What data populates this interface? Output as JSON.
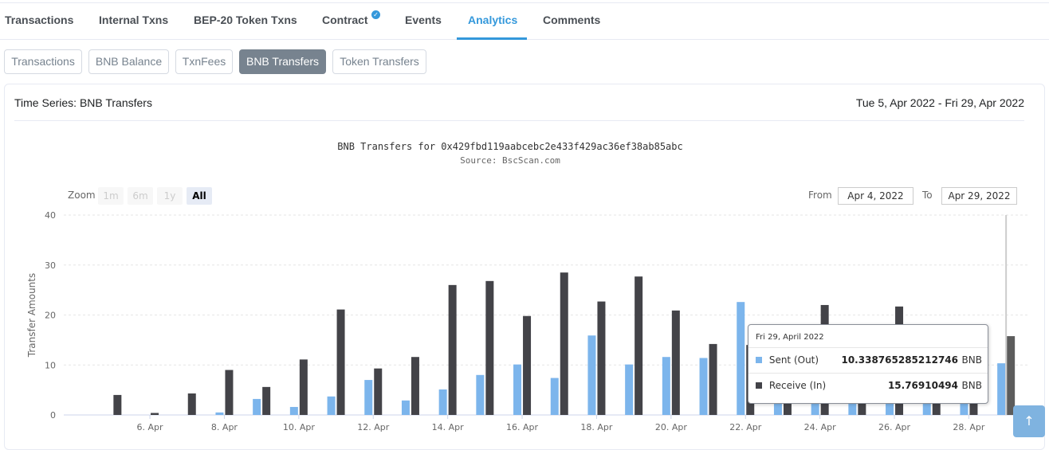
{
  "tabs": [
    {
      "label": "Transactions"
    },
    {
      "label": "Internal Txns"
    },
    {
      "label": "BEP-20 Token Txns"
    },
    {
      "label": "Contract"
    },
    {
      "label": "Events"
    },
    {
      "label": "Analytics"
    },
    {
      "label": "Comments"
    }
  ],
  "active_tab": "Analytics",
  "subtabs": [
    {
      "label": "Transactions"
    },
    {
      "label": "BNB Balance"
    },
    {
      "label": "TxnFees"
    },
    {
      "label": "BNB Transfers"
    },
    {
      "label": "Token Transfers"
    }
  ],
  "active_subtab": "BNB Transfers",
  "card": {
    "title": "Time Series: BNB Transfers",
    "range": "Tue 5, Apr 2022 - Fri 29, Apr 2022"
  },
  "chart_header": {
    "title": "BNB Transfers for 0x429fbd119aabcebc2e433f429ac36ef38ab85abc",
    "subtitle": "Source: BscScan.com"
  },
  "zoom": {
    "label": "Zoom",
    "options": [
      "1m",
      "6m",
      "1y",
      "All"
    ],
    "selected": "All"
  },
  "range_selector": {
    "from_label": "From",
    "from_value": "Apr 4, 2022",
    "to_label": "To",
    "to_value": "Apr 29, 2022"
  },
  "colors": {
    "accent": "#3498db",
    "sent": "#7cb5ec",
    "receive": "#434348"
  },
  "chart_data": {
    "type": "bar",
    "ylabel": "Transfer Amounts",
    "ylim": [
      0,
      40
    ],
    "yticks": [
      0,
      10,
      20,
      30,
      40
    ],
    "xticks": [
      "6. Apr",
      "8. Apr",
      "10. Apr",
      "12. Apr",
      "14. Apr",
      "16. Apr",
      "18. Apr",
      "20. Apr",
      "22. Apr",
      "24. Apr",
      "26. Apr",
      "28. Apr"
    ],
    "grid": true,
    "categories": [
      "2022-04-05",
      "2022-04-06",
      "2022-04-07",
      "2022-04-08",
      "2022-04-09",
      "2022-04-10",
      "2022-04-11",
      "2022-04-12",
      "2022-04-13",
      "2022-04-14",
      "2022-04-15",
      "2022-04-16",
      "2022-04-17",
      "2022-04-18",
      "2022-04-19",
      "2022-04-20",
      "2022-04-21",
      "2022-04-22",
      "2022-04-23",
      "2022-04-24",
      "2022-04-25",
      "2022-04-26",
      "2022-04-27",
      "2022-04-28",
      "2022-04-29"
    ],
    "series": [
      {
        "name": "Sent (Out)",
        "values": [
          0,
          0,
          0,
          0.5,
          3.2,
          1.6,
          3.7,
          7.0,
          2.9,
          5.1,
          8.0,
          10.1,
          7.4,
          15.9,
          10.1,
          11.6,
          11.4,
          22.6,
          4.0,
          3.0,
          3.0,
          3.0,
          3.0,
          3.0,
          10.338765285212746
        ]
      },
      {
        "name": "Receive (In)",
        "values": [
          4.0,
          0.4,
          4.3,
          9.0,
          5.6,
          11.1,
          21.1,
          9.3,
          11.6,
          26.0,
          26.8,
          19.8,
          28.5,
          22.7,
          27.7,
          20.9,
          14.2,
          14.0,
          5.0,
          22.0,
          5.0,
          21.7,
          5.0,
          4.0,
          15.76910494
        ]
      }
    ]
  },
  "tooltip": {
    "date": "Fri 29, April 2022",
    "rows": [
      {
        "name": "Sent (Out)",
        "value": "10.338765285212746",
        "unit": "BNB"
      },
      {
        "name": "Receive (In)",
        "value": "15.76910494",
        "unit": "BNB"
      }
    ]
  },
  "scroll_top_icon": "arrow-up-icon"
}
